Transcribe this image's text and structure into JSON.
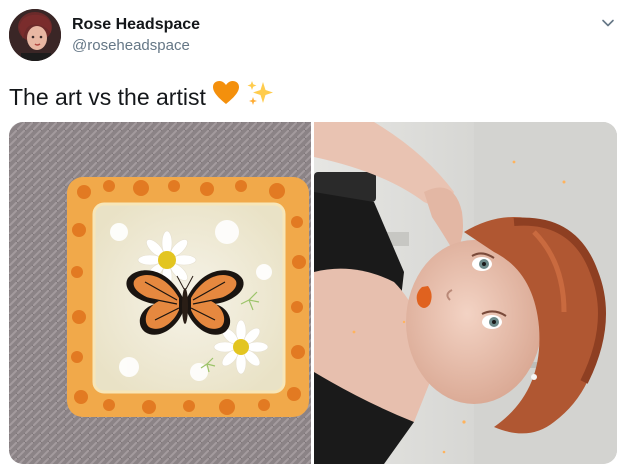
{
  "tweet": {
    "display_name": "Rose Headspace",
    "handle": "@roseheadspace",
    "text": "The art vs the artist",
    "emojis": [
      "orange-heart-icon",
      "sparkles-icon"
    ]
  },
  "icons": {
    "caret": "chevron-down-icon"
  },
  "colors": {
    "name": "#14171a",
    "handle": "#657786",
    "heart": "#f4900c",
    "sparkles": "#ffcc4d",
    "carpet": "#8e8588",
    "resin_frame": "#f0a53a",
    "butterfly_orange": "#e0803a",
    "hair": "#b55a36",
    "background_right": "#d9d9d6"
  },
  "media": {
    "left_subject": "resin-coaster-butterfly",
    "right_subject": "artist-selfie"
  }
}
